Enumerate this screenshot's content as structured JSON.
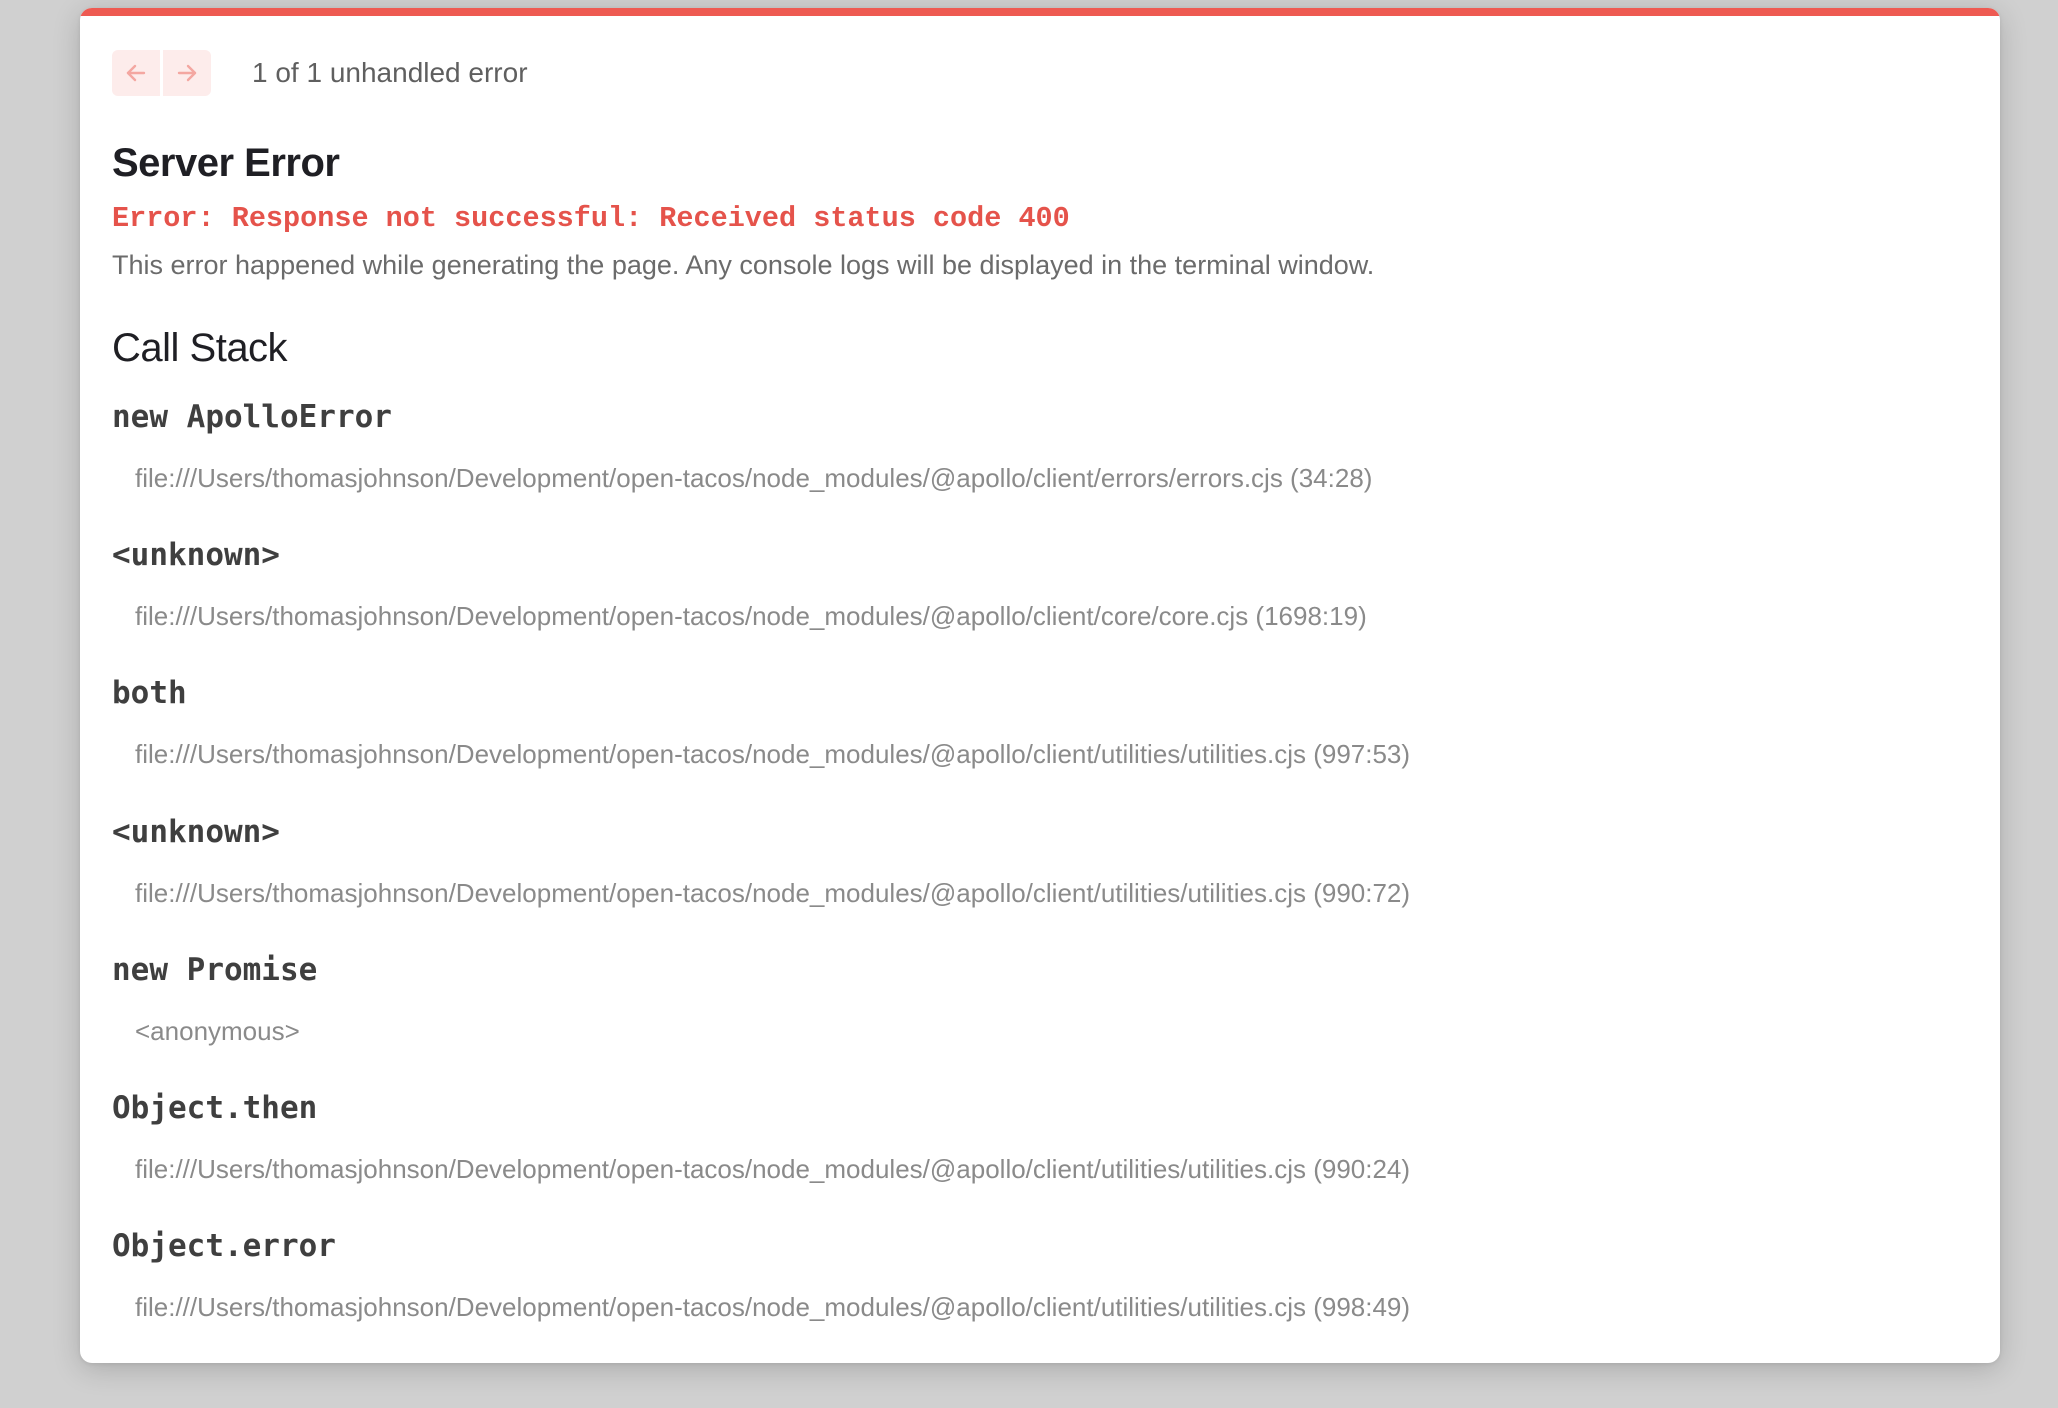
{
  "navigation": {
    "prev_icon": "arrow-left-icon",
    "next_icon": "arrow-right-icon",
    "error_count": "1 of 1 unhandled error"
  },
  "error": {
    "title": "Server Error",
    "message": "Error: Response not successful: Received status code 400",
    "description": "This error happened while generating the page. Any console logs will be displayed in the terminal window."
  },
  "call_stack": {
    "title": "Call Stack",
    "frames": [
      {
        "function": "new ApolloError",
        "location": "file:///Users/thomasjohnson/Development/open-tacos/node_modules/@apollo/client/errors/errors.cjs (34:28)"
      },
      {
        "function": "<unknown>",
        "location": "file:///Users/thomasjohnson/Development/open-tacos/node_modules/@apollo/client/core/core.cjs (1698:19)"
      },
      {
        "function": "both",
        "location": "file:///Users/thomasjohnson/Development/open-tacos/node_modules/@apollo/client/utilities/utilities.cjs (997:53)"
      },
      {
        "function": "<unknown>",
        "location": "file:///Users/thomasjohnson/Development/open-tacos/node_modules/@apollo/client/utilities/utilities.cjs (990:72)"
      },
      {
        "function": "new Promise",
        "location": "<anonymous>"
      },
      {
        "function": "Object.then",
        "location": "file:///Users/thomasjohnson/Development/open-tacos/node_modules/@apollo/client/utilities/utilities.cjs (990:24)"
      },
      {
        "function": "Object.error",
        "location": "file:///Users/thomasjohnson/Development/open-tacos/node_modules/@apollo/client/utilities/utilities.cjs (998:49)"
      }
    ]
  },
  "colors": {
    "accent": "#ee5a52",
    "error_text": "#e5534b",
    "nav_button_bg": "#fdeceb",
    "nav_arrow": "#f4a7a1"
  }
}
